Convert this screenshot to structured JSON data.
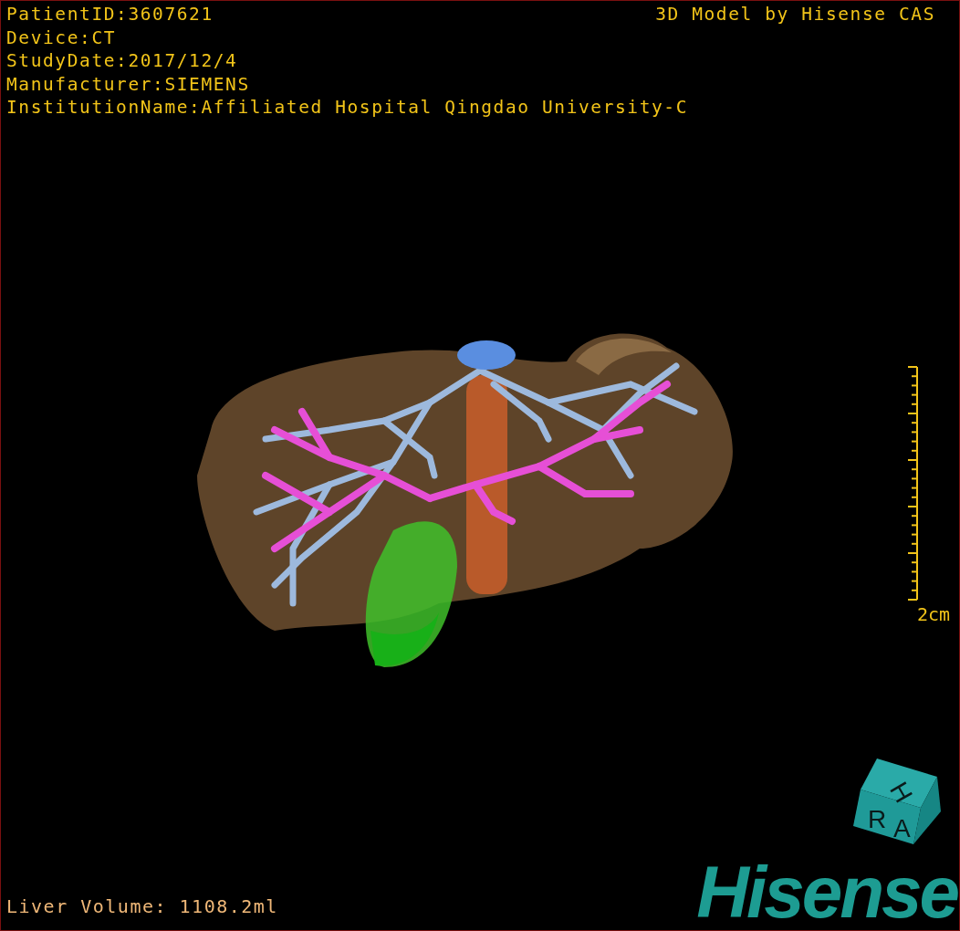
{
  "info_lines": [
    "PatientID:3607621",
    "Device:CT",
    "StudyDate:2017/12/4",
    "Manufacturer:SIEMENS",
    "InstitutionName:Affiliated Hospital Qingdao University-C"
  ],
  "title": "3D Model by Hisense CAS",
  "scale_bar": {
    "label": "2cm"
  },
  "orientation_cube": {
    "labels": [
      "H",
      "R",
      "A"
    ]
  },
  "liver_volume": "Liver Volume: 1108.2ml",
  "logo": "Hisense"
}
